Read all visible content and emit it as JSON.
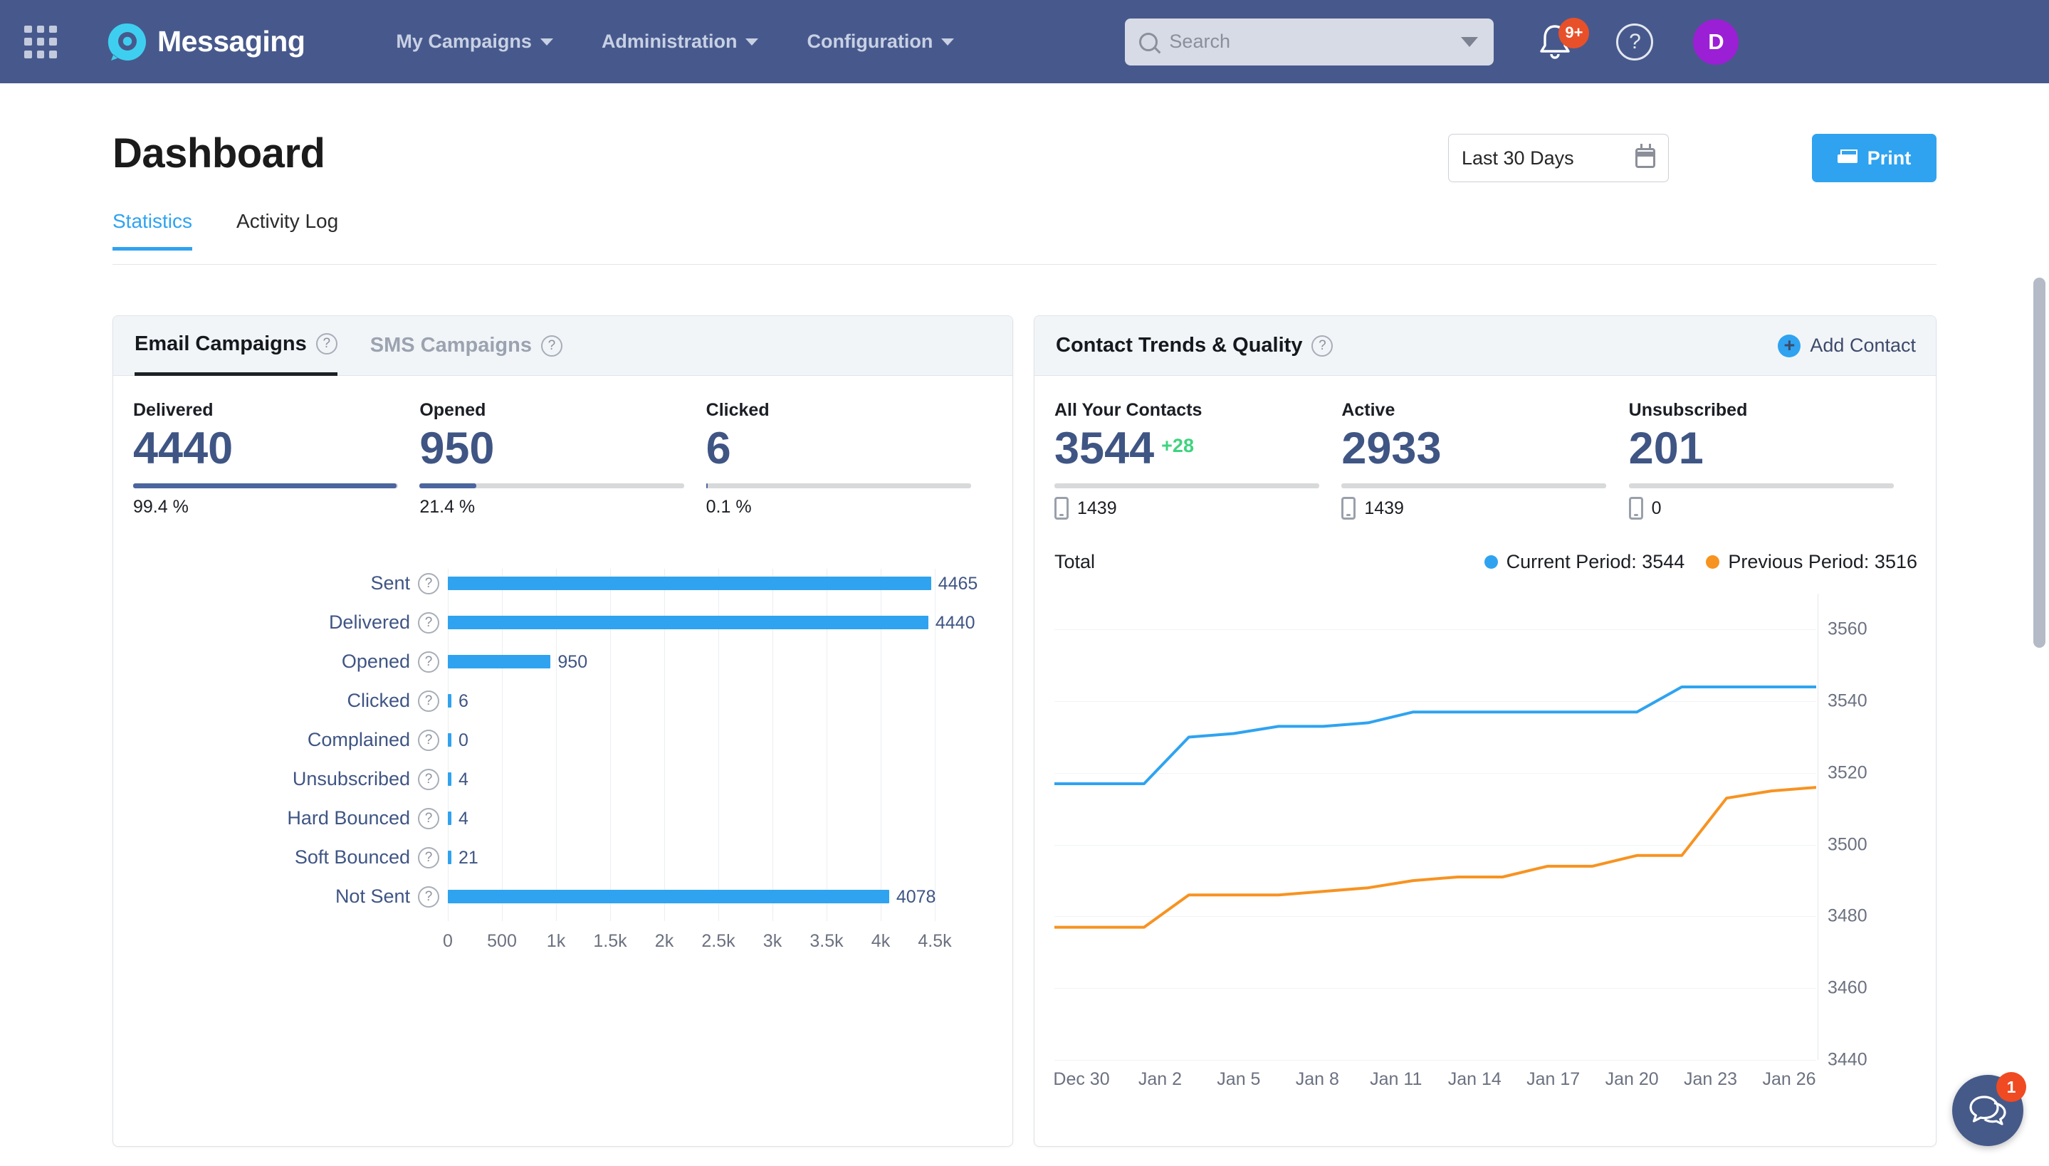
{
  "topnav": {
    "apps_icon": "grid-apps-icon",
    "brand": "Messaging",
    "links": [
      {
        "label": "My Campaigns"
      },
      {
        "label": "Administration"
      },
      {
        "label": "Configuration"
      }
    ],
    "search": {
      "placeholder": "Search",
      "icon": "search-icon"
    },
    "notifications": {
      "icon": "bell-icon",
      "badge": "9+"
    },
    "help": {
      "icon": "help-circle-icon",
      "glyph": "?"
    },
    "avatar": {
      "initial": "D"
    },
    "colors": {
      "bar": "#47598c",
      "brand_accent": "#3ecff0",
      "badge": "#e8502a",
      "avatar": "#9b1fd4"
    }
  },
  "page": {
    "title": "Dashboard",
    "date_range": "Last 30 Days",
    "date_range_icon": "calendar-icon",
    "print_label": "Print",
    "print_icon": "printer-icon",
    "tabs": [
      {
        "label": "Statistics",
        "active": true
      },
      {
        "label": "Activity Log",
        "active": false
      }
    ]
  },
  "email_panel": {
    "tabs": [
      {
        "label": "Email Campaigns",
        "active": true,
        "help": "?"
      },
      {
        "label": "SMS Campaigns",
        "active": false,
        "help": "?"
      }
    ],
    "kpis": [
      {
        "label": "Delivered",
        "value": "4440",
        "percent": "99.4 %",
        "fill": 99.4
      },
      {
        "label": "Opened",
        "value": "950",
        "percent": "21.4 %",
        "fill": 21.4
      },
      {
        "label": "Clicked",
        "value": "6",
        "percent": "0.1 %",
        "fill": 0.4
      }
    ],
    "chart_data": {
      "type": "bar",
      "orientation": "horizontal",
      "title": "Email Campaigns",
      "xlabel": "",
      "ylabel": "",
      "xlim": [
        0,
        4750
      ],
      "grid": true,
      "categories": [
        "Sent",
        "Delivered",
        "Opened",
        "Clicked",
        "Complained",
        "Unsubscribed",
        "Hard Bounced",
        "Soft Bounced",
        "Not Sent"
      ],
      "values": [
        4465,
        4440,
        950,
        6,
        0,
        4,
        4,
        21,
        4078
      ],
      "value_labels": [
        "4465",
        "4440",
        "950",
        "6",
        "0",
        "4",
        "4",
        "21",
        "4078"
      ],
      "xticks": [
        "0",
        "500",
        "1k",
        "1.5k",
        "2k",
        "2.5k",
        "3k",
        "3.5k",
        "4k",
        "4.5k"
      ],
      "xtick_values": [
        0,
        500,
        1000,
        1500,
        2000,
        2500,
        3000,
        3500,
        4000,
        4500
      ],
      "bar_color": "#2fa3f0",
      "label_color": "#3f5584"
    }
  },
  "contacts_panel": {
    "title": "Contact Trends & Quality",
    "help": "?",
    "add_contact": "Add Contact",
    "add_contact_icon": "plus-circle-icon",
    "kpis": [
      {
        "label": "All Your Contacts",
        "value": "3544",
        "delta": "+28",
        "mobile": "1439",
        "mobile_icon": "mobile-icon"
      },
      {
        "label": "Active",
        "value": "2933",
        "delta": "",
        "mobile": "1439",
        "mobile_icon": "mobile-icon"
      },
      {
        "label": "Unsubscribed",
        "value": "201",
        "delta": "",
        "mobile": "0",
        "mobile_icon": "mobile-icon"
      }
    ],
    "legend_total": "Total",
    "chart_data": {
      "type": "line",
      "title": "Contact Trends & Quality",
      "xlabel": "",
      "ylabel": "",
      "ylim": [
        3440,
        3570
      ],
      "yticks": [
        3560,
        3540,
        3520,
        3500,
        3480,
        3460,
        3440
      ],
      "ytick_labels": [
        "3560",
        "3540",
        "3520",
        "3500",
        "3480",
        "3460",
        "3440"
      ],
      "grid": true,
      "legend_position": "top-right",
      "x": [
        "Dec 30",
        "Jan 2",
        "Jan 5",
        "Jan 8",
        "Jan 11",
        "Jan 14",
        "Jan 17",
        "Jan 20",
        "Jan 23",
        "Jan 26"
      ],
      "xtick_labels": [
        "Dec 30",
        "Jan 2",
        "Jan 5",
        "Jan 8",
        "Jan 11",
        "Jan 14",
        "Jan 17",
        "Jan 20",
        "Jan 23",
        "Jan 26"
      ],
      "series": [
        {
          "name": "Current Period: 3544",
          "legend_label": "Current Period: 3544",
          "color": "#2fa3f0",
          "final_value": 3544,
          "values": [
            3517,
            3517,
            3517,
            3530,
            3531,
            3533,
            3533,
            3534,
            3537,
            3537,
            3537,
            3537,
            3537,
            3537,
            3544,
            3544,
            3544,
            3544
          ]
        },
        {
          "name": "Previous Period: 3516",
          "legend_label": "Previous Period: 3516",
          "color": "#f79321",
          "final_value": 3516,
          "values": [
            3477,
            3477,
            3477,
            3486,
            3486,
            3486,
            3487,
            3488,
            3490,
            3491,
            3491,
            3494,
            3494,
            3497,
            3497,
            3513,
            3515,
            3516
          ]
        }
      ]
    }
  },
  "chat_widget": {
    "icon": "chat-bubbles-icon",
    "badge": "1"
  }
}
